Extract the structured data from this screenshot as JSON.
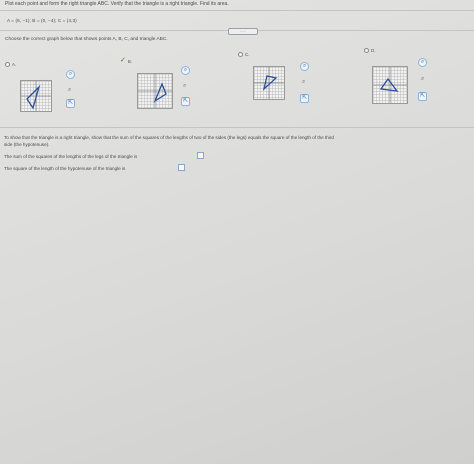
{
  "question": {
    "instruction": "Plot each point and form the right triangle ABC. Verify that the triangle is a right triangle. Find its area.",
    "points": "A = (6, −1);  B = (0, −4);  C = (4,3)",
    "expand_label": "....."
  },
  "part1": {
    "prompt": "Choose the correct graph below that shows points A, B, C, and triangle ABC.",
    "options": [
      {
        "label": "A.",
        "selected": false
      },
      {
        "label": "B.",
        "selected": true
      },
      {
        "label": "C.",
        "selected": false
      },
      {
        "label": "D.",
        "selected": false
      }
    ]
  },
  "part2": {
    "line1": "To show that the triangle is a right triangle, show that the sum of the squares of the lengths of two of the sides (the legs) equals the square of the length of the third",
    "line2": "side (the hypotenuse).",
    "legs_label": "The sum of the squares of the lengths of the legs of the triangle is",
    "hyp_label": "The square of the length of the hypotenuse of the triangle is"
  },
  "icons": {
    "zoom_in": "zoom-in-icon",
    "zoom_out": "zoom-out-icon",
    "popout": "popout-icon"
  },
  "colors": {
    "accent": "#3d6fa8",
    "triangle": "#2b4e9b",
    "check": "#3a7d2a"
  }
}
